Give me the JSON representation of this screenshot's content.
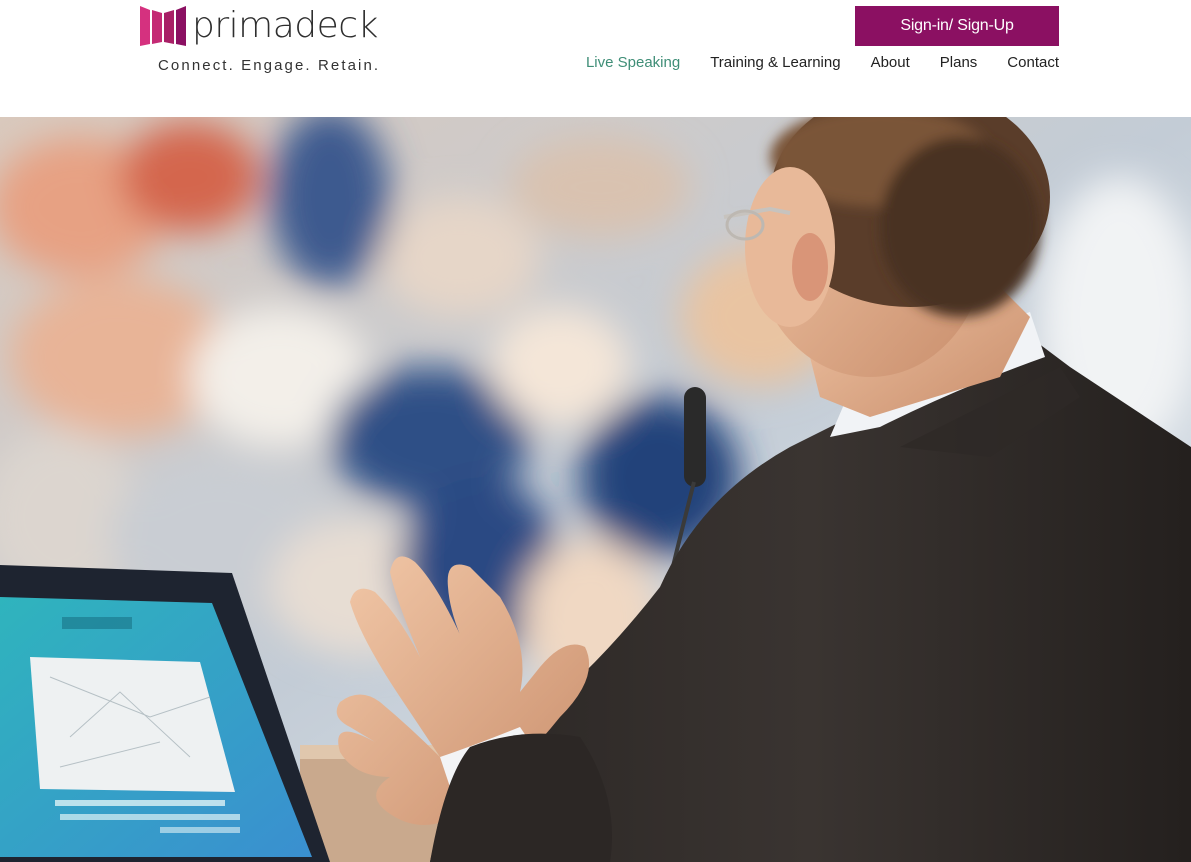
{
  "header": {
    "logo_text": "primadeck",
    "tagline": "Connect. Engage. Retain.",
    "signin_label": "Sign-in/ Sign-Up",
    "nav": [
      {
        "label": "Live Speaking",
        "active": true
      },
      {
        "label": "Training & Learning",
        "active": false
      },
      {
        "label": "About",
        "active": false
      },
      {
        "label": "Plans",
        "active": false
      },
      {
        "label": "Contact",
        "active": false
      }
    ]
  },
  "colors": {
    "brand": "#8b1062",
    "logo_mark": "#d5317f",
    "nav_active": "#3f8e77"
  },
  "hero": {
    "image": "speaker-at-podium-photo"
  }
}
